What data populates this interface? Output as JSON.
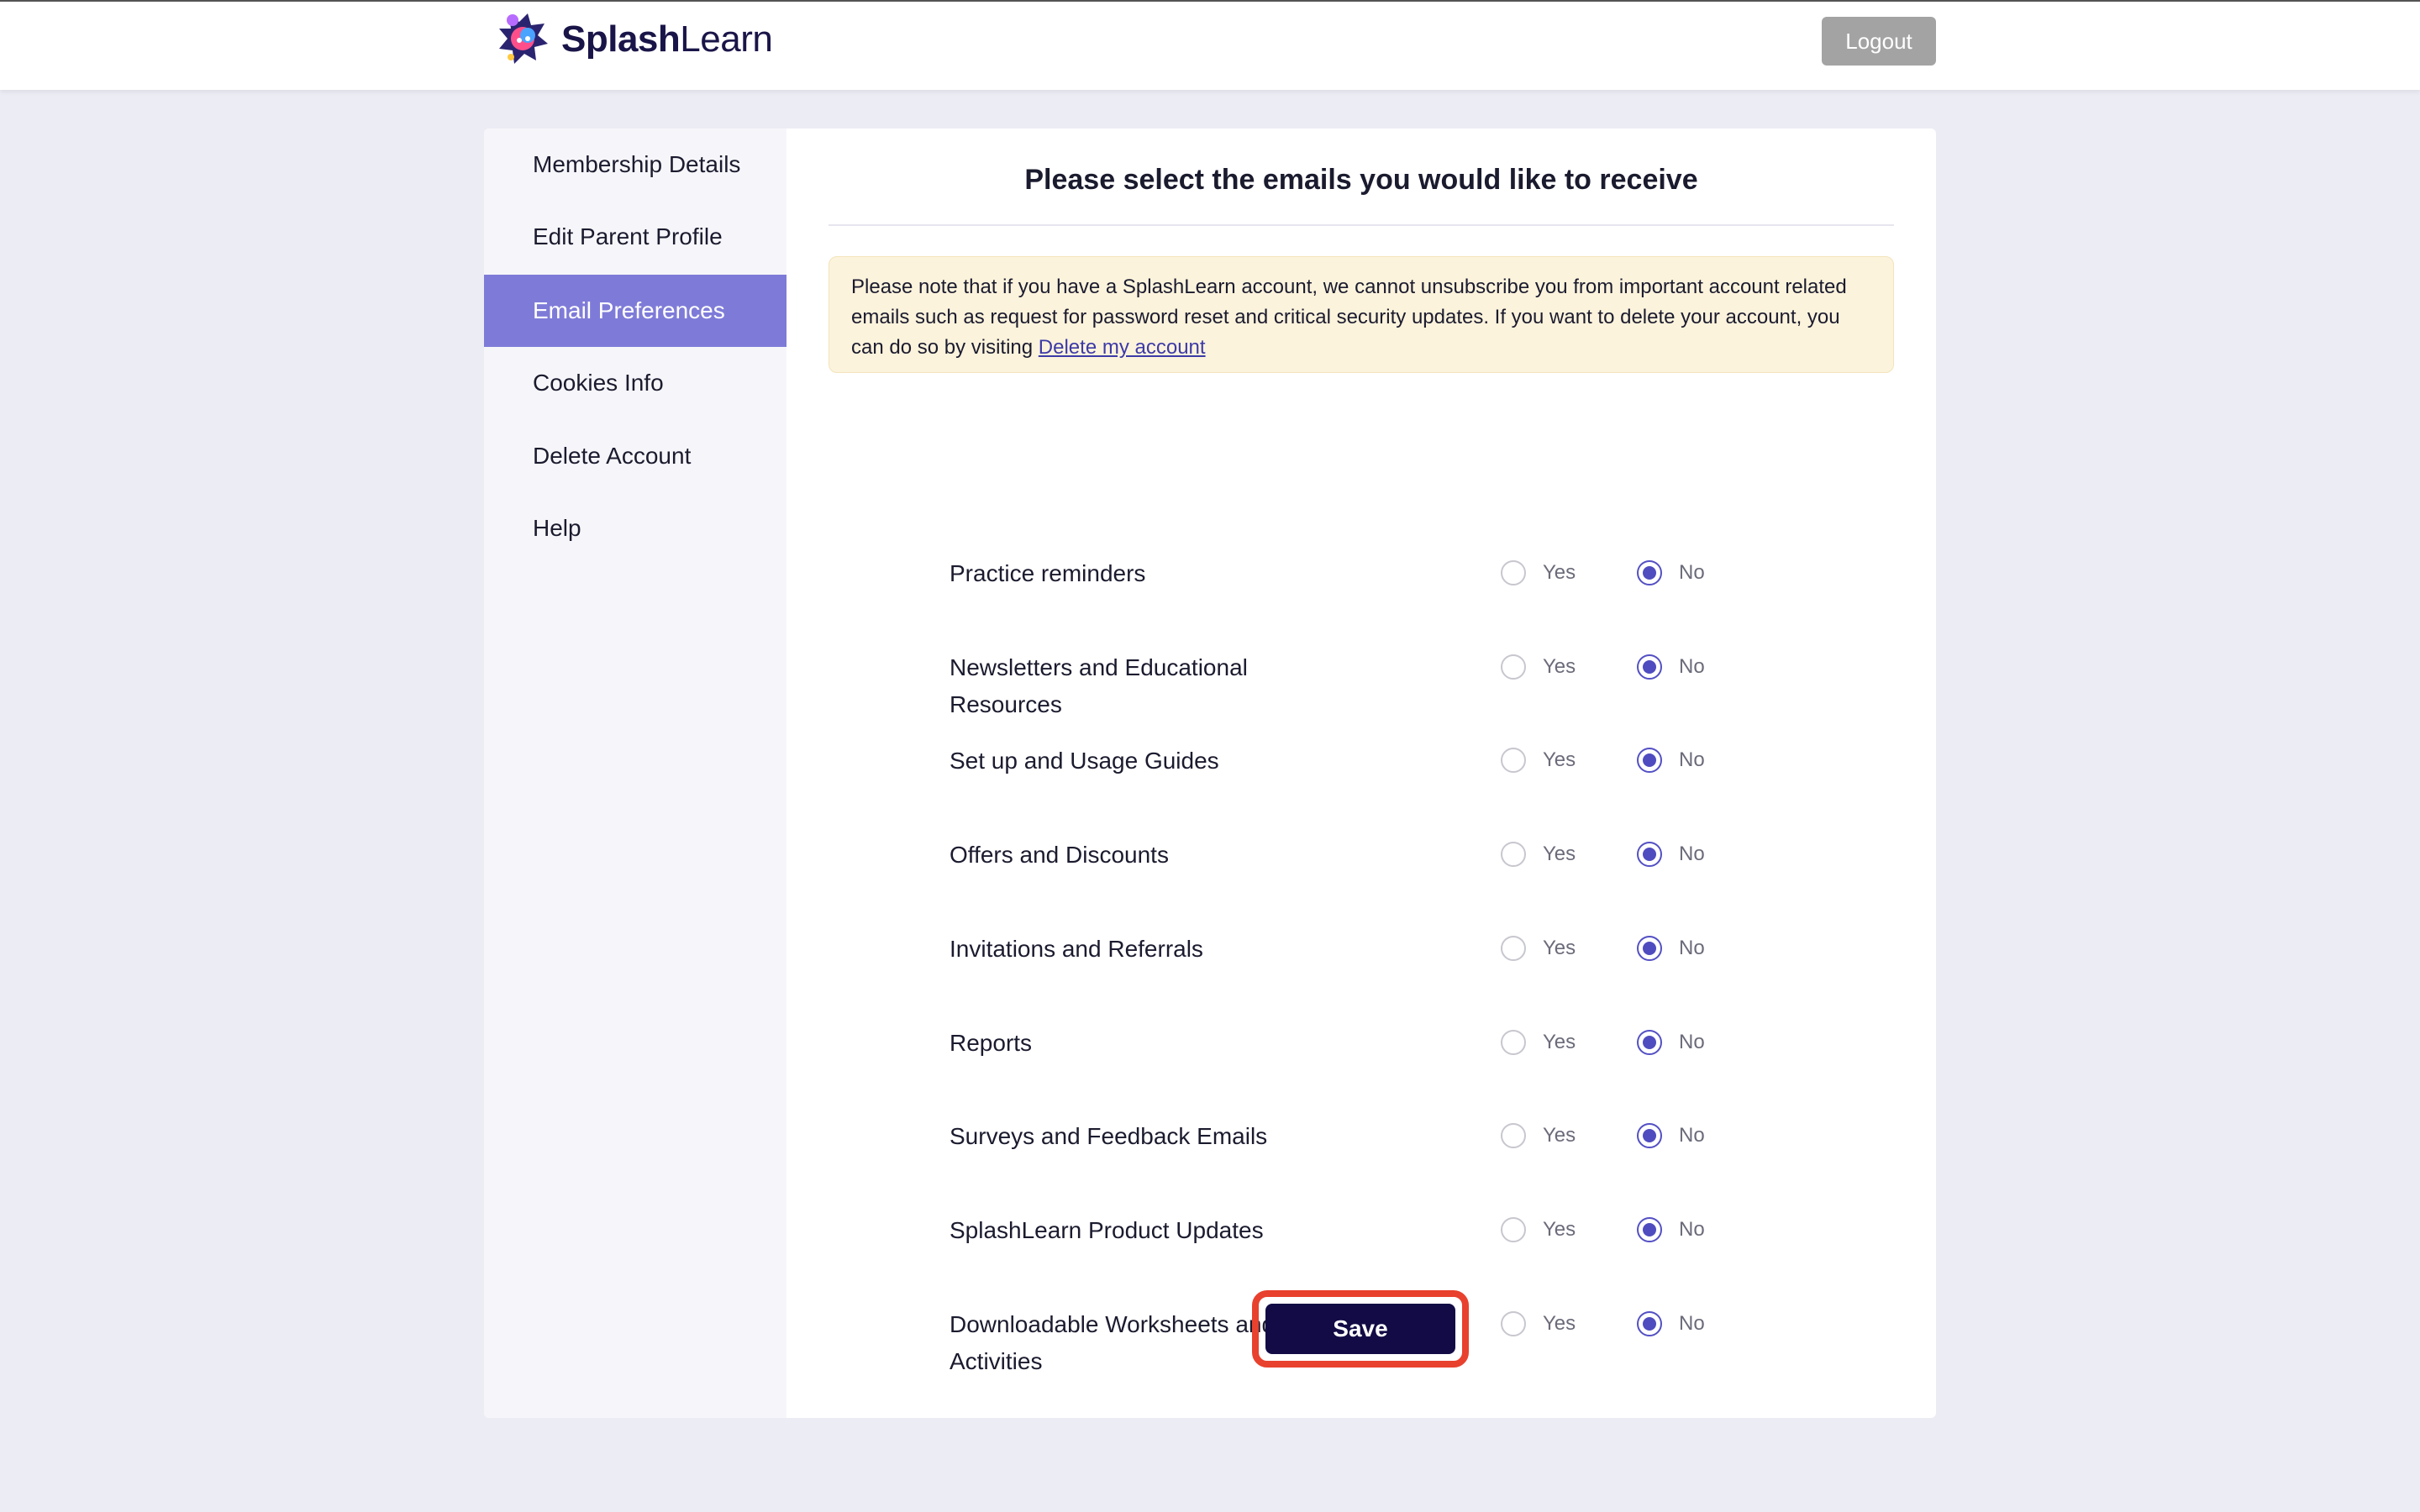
{
  "header": {
    "brand_bold": "Splash",
    "brand_light": "Learn",
    "logout_label": "Logout"
  },
  "sidebar": {
    "items": [
      {
        "label": "Membership Details"
      },
      {
        "label": "Edit Parent Profile"
      },
      {
        "label": "Email Preferences",
        "active": true
      },
      {
        "label": "Cookies Info"
      },
      {
        "label": "Delete Account"
      },
      {
        "label": "Help"
      }
    ]
  },
  "main": {
    "title": "Please select the emails you would like to receive",
    "notice_text": "Please note that if you have a SplashLearn account, we cannot unsubscribe you from important account related emails such as request for password reset and critical security updates. If you want to delete your account, you can do so by visiting ",
    "notice_link": "Delete my account",
    "yes_label": "Yes",
    "no_label": "No",
    "preferences": [
      {
        "label": "Practice reminders",
        "selected": "No"
      },
      {
        "label": "Newsletters and Educational Resources",
        "selected": "No"
      },
      {
        "label": "Set up and Usage Guides",
        "selected": "No"
      },
      {
        "label": "Offers and Discounts",
        "selected": "No"
      },
      {
        "label": "Invitations and Referrals",
        "selected": "No"
      },
      {
        "label": "Reports",
        "selected": "No"
      },
      {
        "label": "Surveys and Feedback Emails",
        "selected": "No"
      },
      {
        "label": "SplashLearn Product Updates",
        "selected": "No"
      },
      {
        "label": "Downloadable Worksheets and Activities",
        "selected": "No"
      }
    ],
    "save_label": "Save"
  },
  "colors": {
    "page_bg": "#ececf5",
    "accent": "#7e7bd8",
    "radio_checked": "#4f4cc0",
    "save_bg": "#120b45",
    "save_highlight": "#e8412e",
    "notice_bg": "#fcf3dc"
  }
}
